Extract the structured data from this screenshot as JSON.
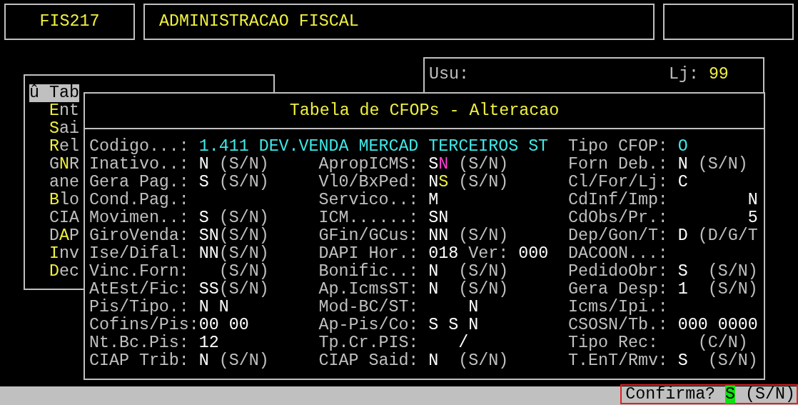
{
  "header": {
    "code": "FIS217",
    "title": "ADMINISTRACAO FISCAL"
  },
  "user_panel": {
    "user_label": "Usu:",
    "store_label": "Lj:",
    "store": "99"
  },
  "menu": {
    "items": [
      {
        "selected": true,
        "segments": [
          {
            "text": "û Tab",
            "hotkey": false
          }
        ]
      },
      {
        "selected": false,
        "segments": [
          {
            "text": "E",
            "hotkey": true
          },
          {
            "text": "nt",
            "hotkey": false
          }
        ]
      },
      {
        "selected": false,
        "segments": [
          {
            "text": "S",
            "hotkey": true
          },
          {
            "text": "ai",
            "hotkey": false
          }
        ]
      },
      {
        "selected": false,
        "segments": [
          {
            "text": "R",
            "hotkey": true
          },
          {
            "text": "el",
            "hotkey": false
          }
        ]
      },
      {
        "selected": false,
        "segments": [
          {
            "text": "G",
            "hotkey": false
          },
          {
            "text": "N",
            "hotkey": true
          },
          {
            "text": "R",
            "hotkey": false
          }
        ]
      },
      {
        "selected": false,
        "segments": [
          {
            "text": "ane",
            "hotkey": false
          }
        ]
      },
      {
        "selected": false,
        "segments": [
          {
            "text": "B",
            "hotkey": true
          },
          {
            "text": "lo",
            "hotkey": false
          }
        ]
      },
      {
        "selected": false,
        "segments": [
          {
            "text": "CIA",
            "hotkey": false
          }
        ]
      },
      {
        "selected": false,
        "segments": [
          {
            "text": "D",
            "hotkey": false
          },
          {
            "text": "A",
            "hotkey": true
          },
          {
            "text": "P",
            "hotkey": false
          }
        ]
      },
      {
        "selected": false,
        "segments": [
          {
            "text": "I",
            "hotkey": true
          },
          {
            "text": "nv",
            "hotkey": false
          }
        ]
      },
      {
        "selected": false,
        "segments": [
          {
            "text": "D",
            "hotkey": true
          },
          {
            "text": "ec",
            "hotkey": false
          }
        ]
      }
    ]
  },
  "dialog": {
    "title": "Tabela de CFOPs - Alteracao",
    "rows": [
      [
        {
          "kind": "wide",
          "label": "Codigo...:",
          "parts": [
            {
              "text": "1.411 DEV.VENDA MERCAD TERCEIROS ST",
              "kind": "code"
            }
          ]
        },
        "",
        {
          "kind": "field",
          "label": "Tipo CFOP:",
          "parts": [
            {
              "text": "O",
              "kind": "code"
            }
          ]
        }
      ],
      [
        {
          "kind": "field",
          "label": "Inativo..:",
          "parts": [
            {
              "text": "N",
              "kind": "value"
            },
            {
              "text": " (S/N)",
              "kind": "hint"
            }
          ]
        },
        {
          "kind": "field",
          "label": "ApropICMS:",
          "parts": [
            {
              "text": "S",
              "kind": "value"
            },
            {
              "text": "N",
              "kind": "value",
              "color": "#ff3fd0"
            },
            {
              "text": " (S/N)",
              "kind": "hint"
            }
          ]
        },
        {
          "kind": "field",
          "label": "Forn Deb.:",
          "parts": [
            {
              "text": "N",
              "kind": "value"
            },
            {
              "text": " (S/N)",
              "kind": "hint"
            }
          ]
        }
      ],
      [
        {
          "kind": "field",
          "label": "Gera Pag.:",
          "parts": [
            {
              "text": "S",
              "kind": "value"
            },
            {
              "text": " (S/N)",
              "kind": "hint"
            }
          ]
        },
        {
          "kind": "field",
          "label": "Vl0/BxPed:",
          "parts": [
            {
              "text": "N",
              "kind": "value"
            },
            {
              "text": "S",
              "kind": "value",
              "color": "#f0f040"
            },
            {
              "text": " (S/N)",
              "kind": "hint"
            }
          ]
        },
        {
          "kind": "field",
          "label": "Cl/For/Lj:",
          "parts": [
            {
              "text": "C",
              "kind": "value"
            }
          ]
        }
      ],
      [
        {
          "kind": "field",
          "label": "Cond.Pag.:"
        },
        {
          "kind": "field",
          "label": "Servico..:",
          "parts": [
            {
              "text": "M",
              "kind": "value"
            }
          ]
        },
        {
          "kind": "field",
          "label": "CdInf/Imp:",
          "parts": [
            {
              "text": "       N",
              "kind": "value"
            }
          ]
        }
      ],
      [
        {
          "kind": "field",
          "label": "Movimen..:",
          "parts": [
            {
              "text": "S",
              "kind": "value"
            },
            {
              "text": " (S/N)",
              "kind": "hint"
            }
          ]
        },
        {
          "kind": "field",
          "label": "ICM......:",
          "parts": [
            {
              "text": "SN",
              "kind": "value"
            }
          ]
        },
        {
          "kind": "field",
          "label": "CdObs/Pr.:",
          "parts": [
            {
              "text": "       5",
              "kind": "value"
            }
          ]
        }
      ],
      [
        {
          "kind": "field",
          "label": "GiroVenda:",
          "parts": [
            {
              "text": "SN",
              "kind": "value"
            },
            {
              "text": "(S/N)",
              "kind": "hint"
            }
          ]
        },
        {
          "kind": "field",
          "label": "GFin/GCus:",
          "parts": [
            {
              "text": "NN",
              "kind": "value"
            },
            {
              "text": " (S/N)",
              "kind": "hint"
            }
          ]
        },
        {
          "kind": "field",
          "label": "Dep/Gon/T:",
          "parts": [
            {
              "text": "D",
              "kind": "value"
            },
            {
              "text": " (D/G/T",
              "kind": "hint"
            }
          ]
        }
      ],
      [
        {
          "kind": "field",
          "label": "Ise/Difal:",
          "parts": [
            {
              "text": "NN",
              "kind": "value"
            },
            {
              "text": "(S/N)",
              "kind": "hint"
            }
          ]
        },
        {
          "kind": "field",
          "label": "DAPI Hor.:",
          "parts": [
            {
              "text": "018",
              "kind": "value"
            },
            {
              "text": " Ver: ",
              "kind": "hint"
            },
            {
              "text": "000",
              "kind": "value"
            }
          ]
        },
        {
          "kind": "field",
          "label": "DACOON...:"
        }
      ],
      [
        {
          "kind": "field",
          "label": "Vinc.Forn:",
          "parts": [
            {
              "text": "  (S/N)",
              "kind": "hint"
            }
          ]
        },
        {
          "kind": "field",
          "label": "Bonific..:",
          "parts": [
            {
              "text": "N",
              "kind": "value"
            },
            {
              "text": "  (S/N)",
              "kind": "hint"
            }
          ]
        },
        {
          "kind": "field",
          "label": "PedidoObr:",
          "parts": [
            {
              "text": "S",
              "kind": "value"
            },
            {
              "text": "  (S/N)",
              "kind": "hint"
            }
          ]
        }
      ],
      [
        {
          "kind": "field",
          "label": "AtEst/Fic:",
          "parts": [
            {
              "text": "SS",
              "kind": "value"
            },
            {
              "text": "(S/N)",
              "kind": "hint"
            }
          ]
        },
        {
          "kind": "field",
          "label": "Ap.IcmsST:",
          "parts": [
            {
              "text": "N",
              "kind": "value"
            },
            {
              "text": "  (S/N)",
              "kind": "hint"
            }
          ]
        },
        {
          "kind": "field",
          "label": "Gera Desp:",
          "parts": [
            {
              "text": "1",
              "kind": "value"
            },
            {
              "text": "  (S/N)",
              "kind": "hint"
            }
          ]
        }
      ],
      [
        {
          "kind": "field",
          "label": "Pis/Tipo.:",
          "parts": [
            {
              "text": "N N",
              "kind": "value"
            }
          ]
        },
        {
          "kind": "field",
          "label": "Mod-BC/ST:",
          "parts": [
            {
              "text": "    N",
              "kind": "value"
            }
          ]
        },
        {
          "kind": "field",
          "label": "Icms/Ipi.:"
        }
      ],
      [
        {
          "kind": "field",
          "label": "Cofins/Pis:",
          "parts": [
            {
              "text": "00 00",
              "kind": "value"
            }
          ]
        },
        {
          "kind": "field",
          "label": "Ap-Pis/Co:",
          "parts": [
            {
              "text": "S S N",
              "kind": "value"
            }
          ]
        },
        {
          "kind": "field",
          "label": "CSOSN/Tb.:",
          "parts": [
            {
              "text": "000 0000",
              "kind": "value"
            }
          ]
        }
      ],
      [
        {
          "kind": "field",
          "label": "Nt.Bc.Pis:",
          "parts": [
            {
              "text": "12",
              "kind": "value"
            }
          ]
        },
        {
          "kind": "field",
          "label": "Tp.Cr.PIS:",
          "parts": [
            {
              "text": "   /",
              "kind": "value"
            }
          ]
        },
        {
          "kind": "field",
          "label": "Tipo Rec:",
          "parts": [
            {
              "text": "  (C/N)",
              "kind": "hint"
            }
          ]
        }
      ],
      [
        {
          "kind": "field",
          "label": "CIAP Trib:",
          "parts": [
            {
              "text": "N",
              "kind": "value"
            },
            {
              "text": " (S/N)",
              "kind": "hint"
            }
          ]
        },
        {
          "kind": "field",
          "label": "CIAP Said:",
          "parts": [
            {
              "text": "N",
              "kind": "value"
            },
            {
              "text": "  (S/N)",
              "kind": "hint"
            }
          ]
        },
        {
          "kind": "field",
          "label": "T.EnT/Rmv:",
          "parts": [
            {
              "text": "S",
              "kind": "value"
            },
            {
              "text": "  (S/N)",
              "kind": "hint"
            }
          ]
        }
      ]
    ]
  },
  "status_bar": {
    "prompt": "Confirma?",
    "answer": "S",
    "hint": "(S/N)",
    "highlighted": true
  }
}
